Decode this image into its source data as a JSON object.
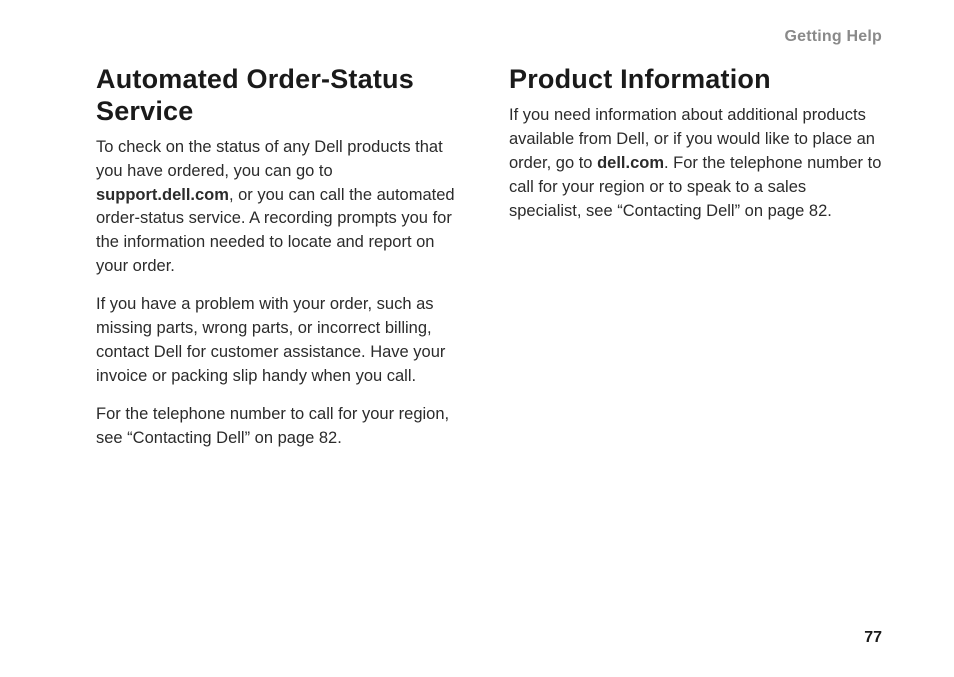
{
  "running_header": "Getting Help",
  "page_number": "77",
  "left": {
    "heading": "Automated Order-Status Service",
    "p1_a": "To check on the status of any Dell products that you have ordered, you can go to ",
    "p1_bold": "support.dell.com",
    "p1_b": ", or you can call the automated order-status service. A recording prompts you for the information needed to locate and report on your order.",
    "p2": "If you have a problem with your order, such as missing parts, wrong parts, or incorrect billing, contact Dell for customer assistance. Have your invoice or packing slip handy when you call.",
    "p3": "For the telephone number to call for your region, see “Contacting Dell” on page 82."
  },
  "right": {
    "heading": "Product Information",
    "p1_a": "If you need information about additional products available from Dell, or if you would like to place an order, go to ",
    "p1_bold": "dell.com",
    "p1_b": ". For the telephone number to call for your region or to speak to a sales specialist, see “Contacting Dell” on page 82."
  }
}
